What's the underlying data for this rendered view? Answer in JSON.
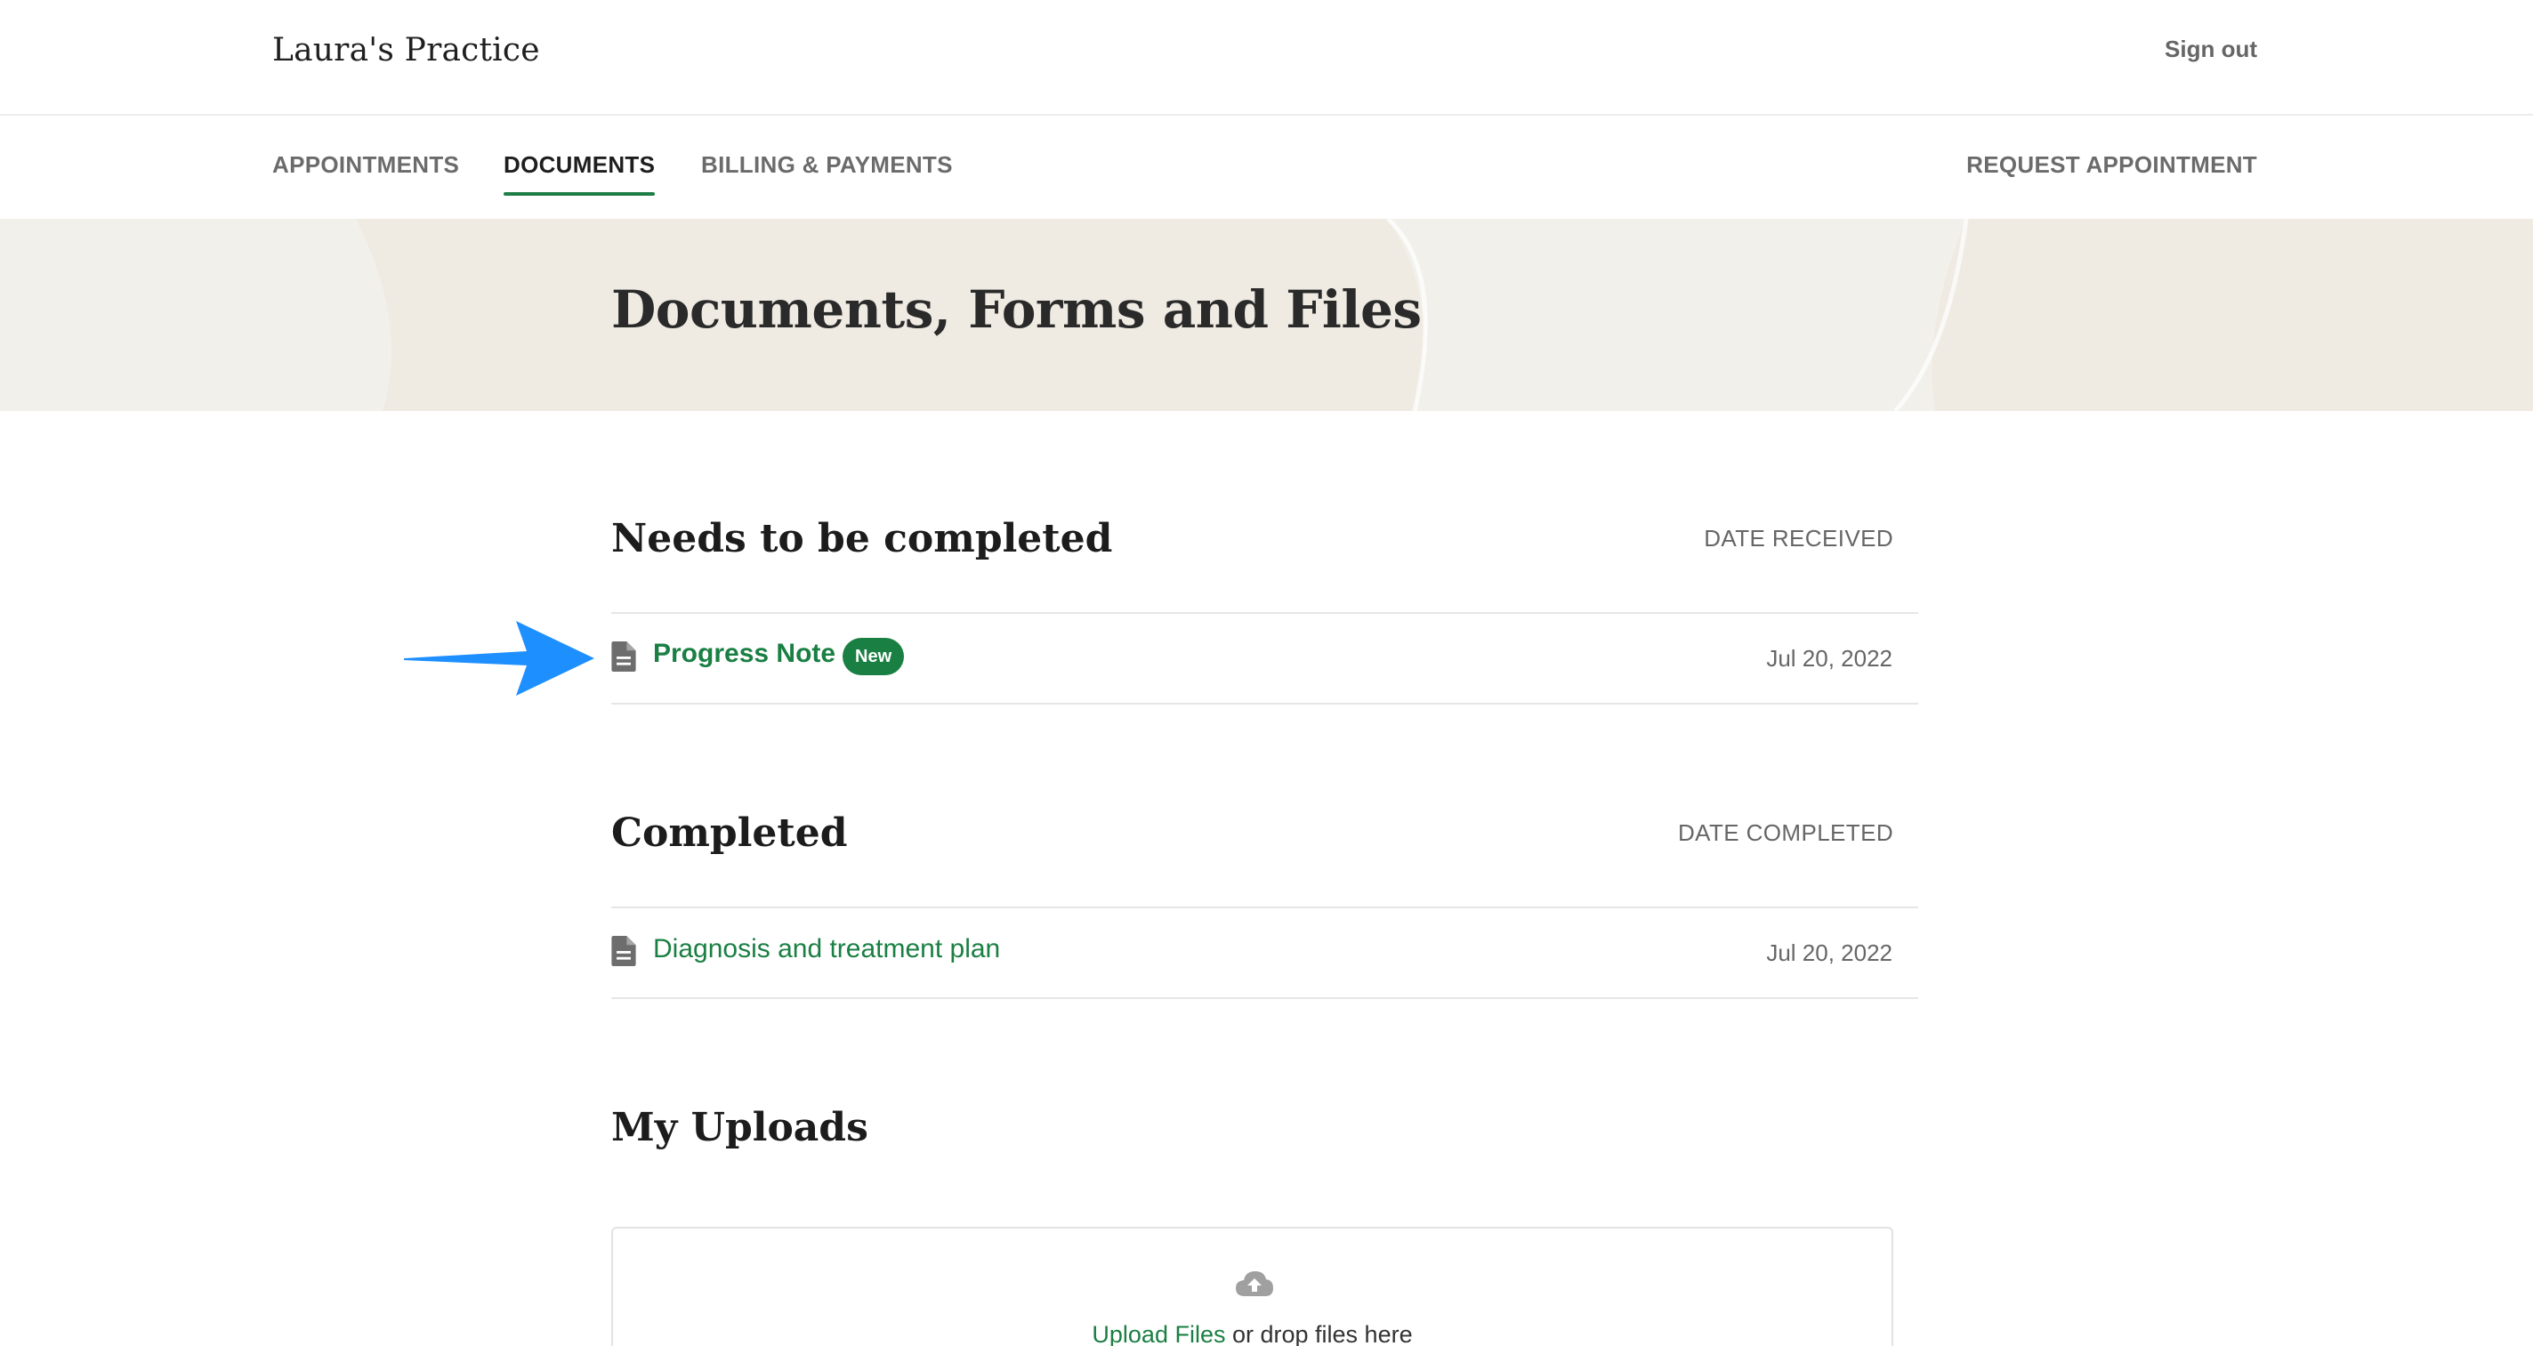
{
  "header": {
    "practice_name": "Laura's Practice",
    "signout_label": "Sign out"
  },
  "nav": {
    "appointments": "APPOINTMENTS",
    "documents": "DOCUMENTS",
    "billing": "BILLING & PAYMENTS",
    "request": "REQUEST APPOINTMENT",
    "active": "documents"
  },
  "page": {
    "title": "Documents, Forms and Files"
  },
  "needs": {
    "title": "Needs to be completed",
    "column_header": "DATE RECEIVED",
    "items": [
      {
        "name": "Progress Note",
        "badge": "New",
        "date": "Jul 20, 2022",
        "icon": "document-icon"
      }
    ]
  },
  "completed": {
    "title": "Completed",
    "column_header": "DATE COMPLETED",
    "items": [
      {
        "name": "Diagnosis and treatment plan",
        "date": "Jul 20, 2022",
        "icon": "document-icon"
      }
    ]
  },
  "uploads": {
    "title": "My Uploads",
    "upload_link": "Upload Files",
    "upload_suffix": " or drop files here",
    "icon": "cloud-upload-icon"
  },
  "colors": {
    "accent": "#1a7f43",
    "banner_bg": "#f2f0ea",
    "callout_arrow": "#1e8fff"
  }
}
